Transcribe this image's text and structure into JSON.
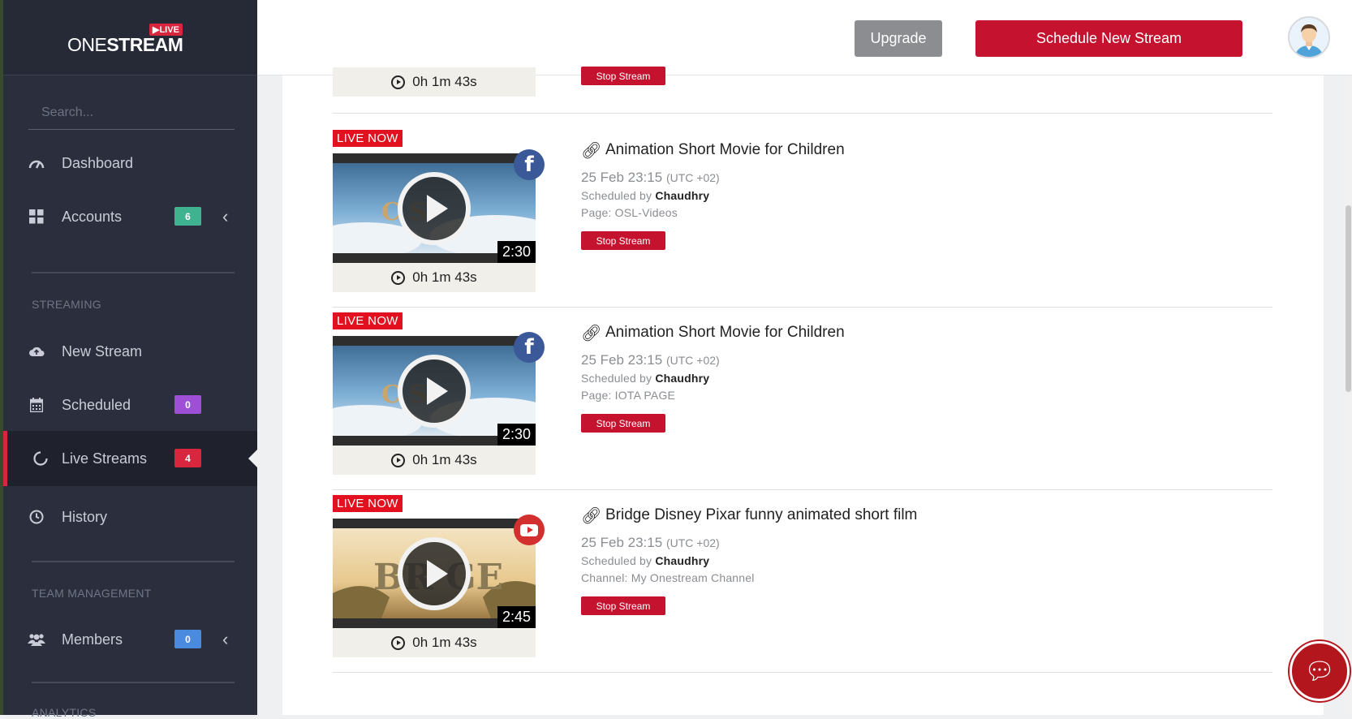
{
  "brand": {
    "name_light": "ONE",
    "name_bold": "STREAM",
    "live_tag": "▶LIVE"
  },
  "sidebar": {
    "search_placeholder": "Search...",
    "items": [
      {
        "label": "Dashboard",
        "icon": "gauge-icon"
      },
      {
        "label": "Accounts",
        "icon": "grid-icon",
        "badge": "6",
        "badge_color": "#3fb38f"
      },
      {
        "label": "New Stream",
        "icon": "cloud-upload-icon"
      },
      {
        "label": "Scheduled",
        "icon": "calendar-icon",
        "badge": "0",
        "badge_color": "#9d4fd6"
      },
      {
        "label": "Live Streams",
        "icon": "circle-notch-icon",
        "badge": "4",
        "badge_color": "#d7263d"
      },
      {
        "label": "History",
        "icon": "clock-icon"
      },
      {
        "label": "Members",
        "icon": "users-icon",
        "badge": "0",
        "badge_color": "#4a8be0"
      }
    ],
    "sections": {
      "streaming": "STREAMING",
      "team": "TEAM MANAGEMENT",
      "analytics": "ANALYTICS"
    }
  },
  "topbar": {
    "upgrade_label": "Upgrade",
    "schedule_label": "Schedule New Stream"
  },
  "streams": [
    {
      "live_label": "",
      "elapsed": "0h 1m 43s",
      "stop_label": "Stop Stream"
    },
    {
      "live_label": "LIVE NOW",
      "network": "facebook",
      "duration": "2:30",
      "elapsed": "0h 1m 43s",
      "title": "Animation Short Movie for Children",
      "date": "25 Feb 23:15",
      "tz": "(UTC +02)",
      "scheduled_by_prefix": "Scheduled by",
      "scheduled_by": "Chaudhry",
      "page": "Page: OSL-Videos",
      "stop_label": "Stop Stream"
    },
    {
      "live_label": "LIVE NOW",
      "network": "facebook",
      "duration": "2:30",
      "elapsed": "0h 1m 43s",
      "title": "Animation Short Movie for Children",
      "date": "25 Feb 23:15",
      "tz": "(UTC +02)",
      "scheduled_by_prefix": "Scheduled by",
      "scheduled_by": "Chaudhry",
      "page": "Page: IOTA PAGE",
      "stop_label": "Stop Stream"
    },
    {
      "live_label": "LIVE NOW",
      "network": "youtube",
      "duration": "2:45",
      "elapsed": "0h 1m 43s",
      "title": "Bridge Disney Pixar funny animated short film",
      "date": "25 Feb 23:15",
      "tz": "(UTC +02)",
      "scheduled_by_prefix": "Scheduled by",
      "scheduled_by": "Chaudhry",
      "page": "Channel: My Onestream Channel",
      "stop_label": "Stop Stream"
    }
  ],
  "colors": {
    "accent": "#c4122f",
    "sidebar_bg": "#2b2f3d",
    "facebook": "#3b5998",
    "youtube": "#d32f2f"
  }
}
